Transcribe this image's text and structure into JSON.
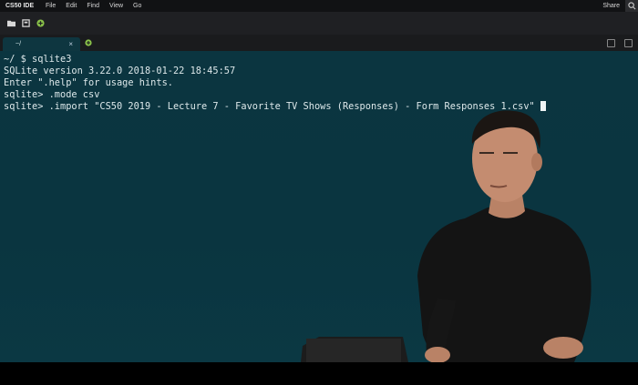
{
  "app": {
    "name": "CS50 IDE"
  },
  "menubar": {
    "items": [
      "File",
      "Edit",
      "Find",
      "View",
      "Go"
    ],
    "share_label": "Share"
  },
  "toolbar": {
    "icons": [
      "folder-icon",
      "new-file-icon",
      "add-icon"
    ]
  },
  "tabs": [
    {
      "label": "~/",
      "close": "×"
    }
  ],
  "terminal": {
    "lines": [
      "~/ $ sqlite3",
      "SQLite version 3.22.0 2018-01-22 18:45:57",
      "Enter \".help\" for usage hints.",
      "sqlite> .mode csv",
      "sqlite> .import \"CS50 2019 - Lecture 7 - Favorite TV Shows (Responses) - Form Responses 1.csv\""
    ]
  },
  "colors": {
    "terminal_bg": "#0b3540",
    "accent_green": "#8bc34a",
    "menubar_bg": "#111214"
  }
}
